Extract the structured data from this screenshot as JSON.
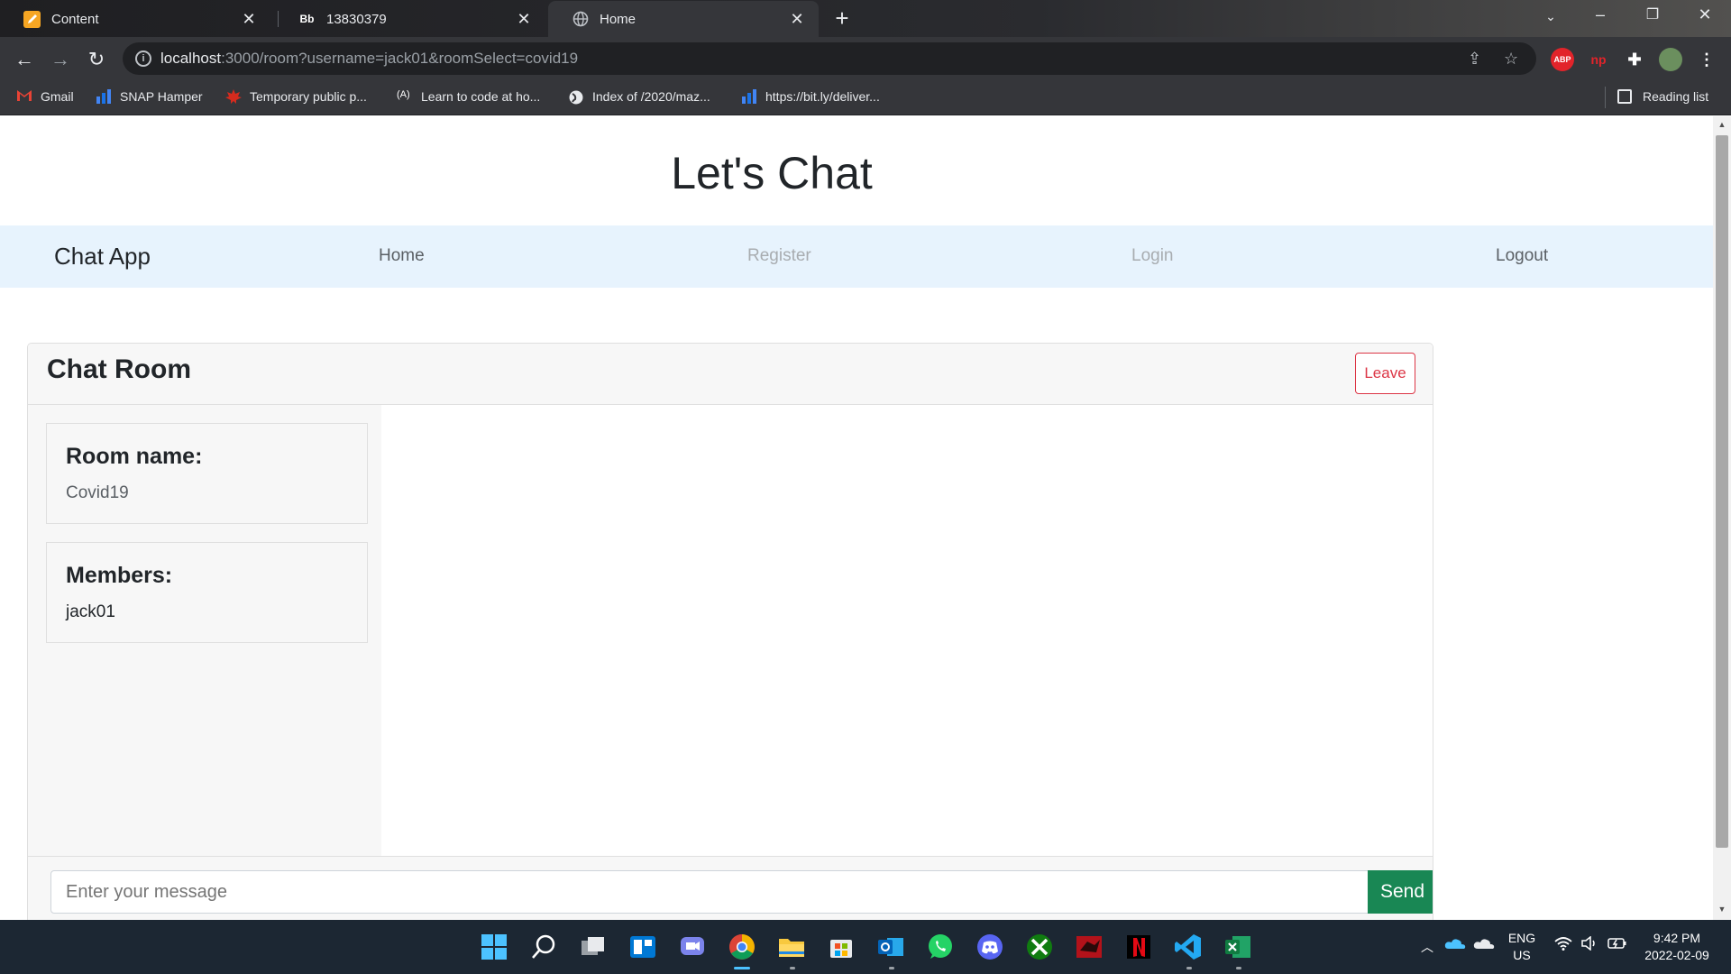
{
  "browser": {
    "tabs": [
      {
        "title": "Content",
        "favicon": "pencil-icon"
      },
      {
        "title": "13830379",
        "favicon": "bb-icon",
        "favicon_text": "Bb"
      },
      {
        "title": "Home",
        "favicon": "globe-icon",
        "active": true
      }
    ],
    "url": {
      "host": "localhost",
      "rest": ":3000/room?username=jack01&roomSelect=covid19"
    },
    "bookmarks": [
      {
        "label": "Gmail",
        "icon": "gmail-icon"
      },
      {
        "label": "SNAP Hamper",
        "icon": "bars-icon"
      },
      {
        "label": "Temporary public p...",
        "icon": "maple-leaf-icon"
      },
      {
        "label": "Learn to code at ho...",
        "icon": "code-icon"
      },
      {
        "label": "Index of /2020/maz...",
        "icon": "globe-icon"
      },
      {
        "label": "https://bit.ly/deliver...",
        "icon": "bars-icon"
      }
    ],
    "reading_list": "Reading list",
    "extensions": {
      "abp": "ABP"
    }
  },
  "page": {
    "headline": "Let's Chat",
    "nav": {
      "brand": "Chat App",
      "links": [
        "Home",
        "Register",
        "Login",
        "Logout"
      ]
    },
    "chat": {
      "title": "Chat Room",
      "leave_label": "Leave",
      "room_name_heading": "Room name:",
      "room_name": "Covid19",
      "members_heading": "Members:",
      "members": [
        "jack01"
      ],
      "input_placeholder": "Enter your message",
      "send_label": "Send"
    }
  },
  "taskbar": {
    "language": "ENG",
    "region": "US",
    "time": "9:42 PM",
    "date": "2022-02-09"
  },
  "colors": {
    "navbar_bg": "#e7f3fd",
    "danger": "#dc3545",
    "success": "#198754",
    "chrome_dark": "#35363a"
  }
}
